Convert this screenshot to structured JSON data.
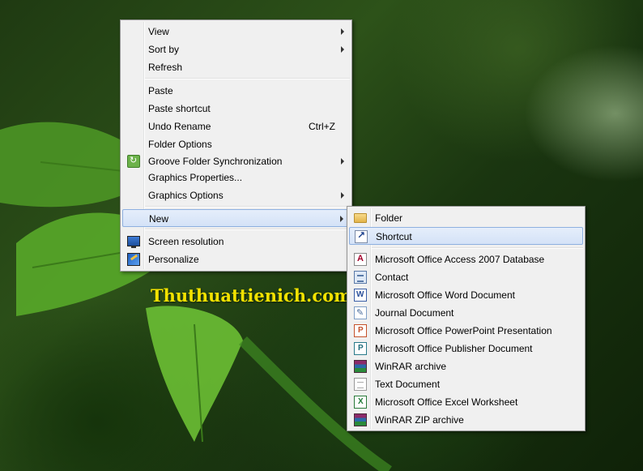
{
  "watermark": "Thuthuattienich.com",
  "context_menu": {
    "items": [
      {
        "label": "View"
      },
      {
        "label": "Sort by"
      },
      {
        "label": "Refresh"
      },
      {
        "label": "Paste"
      },
      {
        "label": "Paste shortcut"
      },
      {
        "label": "Undo Rename",
        "shortcut": "Ctrl+Z"
      },
      {
        "label": "Folder Options"
      },
      {
        "label": "Groove Folder Synchronization"
      },
      {
        "label": "Graphics Properties..."
      },
      {
        "label": "Graphics Options"
      },
      {
        "label": "New"
      },
      {
        "label": "Screen resolution"
      },
      {
        "label": "Personalize"
      }
    ]
  },
  "new_submenu": {
    "items": [
      {
        "label": "Folder",
        "icon": "folder-icon"
      },
      {
        "label": "Shortcut",
        "icon": "shortcut-icon"
      },
      {
        "label": "Microsoft Office Access 2007 Database",
        "icon": "access-icon"
      },
      {
        "label": "Contact",
        "icon": "contact-icon"
      },
      {
        "label": "Microsoft Office Word Document",
        "icon": "word-icon"
      },
      {
        "label": "Journal Document",
        "icon": "journal-icon"
      },
      {
        "label": "Microsoft Office PowerPoint Presentation",
        "icon": "powerpoint-icon"
      },
      {
        "label": "Microsoft Office Publisher Document",
        "icon": "publisher-icon"
      },
      {
        "label": "WinRAR archive",
        "icon": "winrar-icon"
      },
      {
        "label": "Text Document",
        "icon": "text-document-icon"
      },
      {
        "label": "Microsoft Office Excel Worksheet",
        "icon": "excel-icon"
      },
      {
        "label": "WinRAR ZIP archive",
        "icon": "winrar-zip-icon"
      }
    ]
  },
  "colors": {
    "menu_background": "#f0f0f0",
    "highlight": "#d4e2f7",
    "highlight_border": "#8eb0e0",
    "watermark": "#f2e200"
  }
}
